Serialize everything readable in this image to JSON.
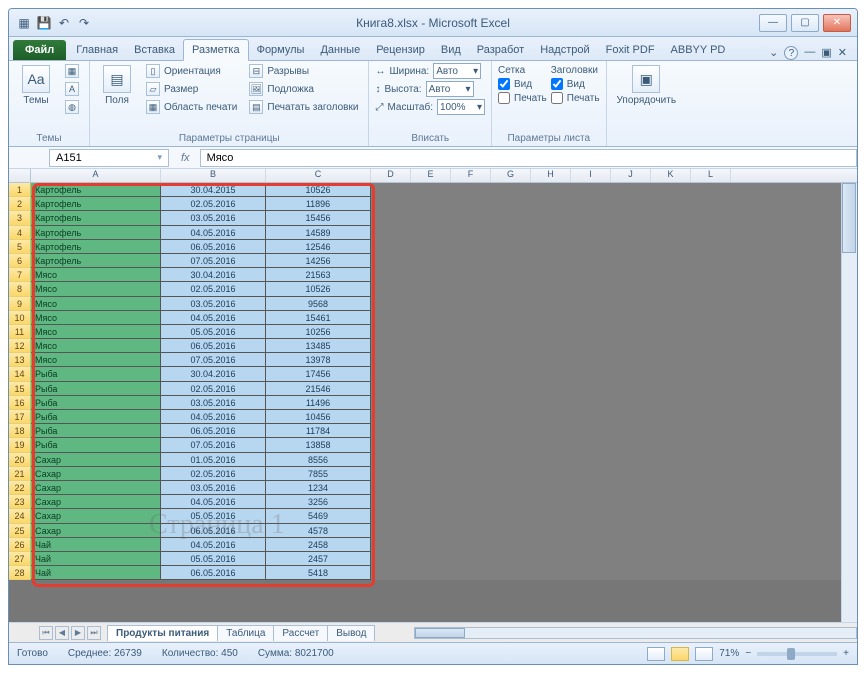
{
  "window": {
    "title": "Книга8.xlsx - Microsoft Excel"
  },
  "qat": {
    "save": "💾",
    "undo": "↶",
    "redo": "↷"
  },
  "tabs": {
    "file": "Файл",
    "items": [
      "Главная",
      "Вставка",
      "Разметка",
      "Формулы",
      "Данные",
      "Рецензир",
      "Вид",
      "Разработ",
      "Надстрой",
      "Foxit PDF",
      "ABBYY PD"
    ],
    "active_index": 2
  },
  "ribbon": {
    "group_themes": {
      "label": "Темы",
      "themes": "Темы"
    },
    "group_page": {
      "label": "Параметры страницы",
      "margins": "Поля",
      "orientation": "Ориентация",
      "size": "Размер",
      "print_area": "Область печати",
      "breaks": "Разрывы",
      "background": "Подложка",
      "titles": "Печатать заголовки"
    },
    "group_fit": {
      "label": "Вписать",
      "width_lbl": "Ширина:",
      "width_val": "Авто",
      "height_lbl": "Высота:",
      "height_val": "Авто",
      "scale_lbl": "Масштаб:",
      "scale_val": "100%"
    },
    "group_sheet": {
      "label": "Параметры листа",
      "grid": "Сетка",
      "headings": "Заголовки",
      "view": "Вид",
      "print": "Печать"
    },
    "group_arrange": {
      "label": "",
      "arrange": "Упорядочить"
    }
  },
  "formula_bar": {
    "name_box": "A151",
    "fx": "fx",
    "formula": "Мясо"
  },
  "columns": [
    "A",
    "B",
    "C",
    "D",
    "E",
    "F",
    "G",
    "H",
    "I",
    "J",
    "K",
    "L"
  ],
  "rows": [
    {
      "n": 1,
      "a": "Картофель",
      "b": "30.04.2015",
      "c": "10526"
    },
    {
      "n": 2,
      "a": "Картофель",
      "b": "02.05.2016",
      "c": "11896"
    },
    {
      "n": 3,
      "a": "Картофель",
      "b": "03.05.2016",
      "c": "15456"
    },
    {
      "n": 4,
      "a": "Картофель",
      "b": "04.05.2016",
      "c": "14589"
    },
    {
      "n": 5,
      "a": "Картофель",
      "b": "06.05.2016",
      "c": "12546"
    },
    {
      "n": 6,
      "a": "Картофель",
      "b": "07.05.2016",
      "c": "14256"
    },
    {
      "n": 7,
      "a": "Мясо",
      "b": "30.04.2016",
      "c": "21563"
    },
    {
      "n": 8,
      "a": "Мясо",
      "b": "02.05.2016",
      "c": "10526"
    },
    {
      "n": 9,
      "a": "Мясо",
      "b": "03.05.2016",
      "c": "9568"
    },
    {
      "n": 10,
      "a": "Мясо",
      "b": "04.05.2016",
      "c": "15461"
    },
    {
      "n": 11,
      "a": "Мясо",
      "b": "05.05.2016",
      "c": "10256"
    },
    {
      "n": 12,
      "a": "Мясо",
      "b": "06.05.2016",
      "c": "13485"
    },
    {
      "n": 13,
      "a": "Мясо",
      "b": "07.05.2016",
      "c": "13978"
    },
    {
      "n": 14,
      "a": "Рыба",
      "b": "30.04.2016",
      "c": "17456"
    },
    {
      "n": 15,
      "a": "Рыба",
      "b": "02.05.2016",
      "c": "21546"
    },
    {
      "n": 16,
      "a": "Рыба",
      "b": "03.05.2016",
      "c": "11496"
    },
    {
      "n": 17,
      "a": "Рыба",
      "b": "04.05.2016",
      "c": "10456"
    },
    {
      "n": 18,
      "a": "Рыба",
      "b": "06.05.2016",
      "c": "11784"
    },
    {
      "n": 19,
      "a": "Рыба",
      "b": "07.05.2016",
      "c": "13858"
    },
    {
      "n": 20,
      "a": "Сахар",
      "b": "01.05.2016",
      "c": "8556"
    },
    {
      "n": 21,
      "a": "Сахар",
      "b": "02.05.2016",
      "c": "7855"
    },
    {
      "n": 22,
      "a": "Сахар",
      "b": "03.05.2016",
      "c": "1234"
    },
    {
      "n": 23,
      "a": "Сахар",
      "b": "04.05.2016",
      "c": "3256"
    },
    {
      "n": 24,
      "a": "Сахар",
      "b": "05.05.2016",
      "c": "5469"
    },
    {
      "n": 25,
      "a": "Сахар",
      "b": "06.05.2016",
      "c": "4578"
    },
    {
      "n": 26,
      "a": "Чай",
      "b": "04.05.2016",
      "c": "2458"
    },
    {
      "n": 27,
      "a": "Чай",
      "b": "05.05.2016",
      "c": "2457"
    },
    {
      "n": 28,
      "a": "Чай",
      "b": "06.05.2016",
      "c": "5418"
    }
  ],
  "watermark": "Страница 1",
  "sheets": {
    "items": [
      "Продукты питания",
      "Таблица",
      "Рассчет",
      "Вывод"
    ],
    "active_index": 0
  },
  "status": {
    "ready": "Готово",
    "avg_lbl": "Среднее:",
    "avg_val": "26739",
    "count_lbl": "Количество:",
    "count_val": "450",
    "sum_lbl": "Сумма:",
    "sum_val": "8021700",
    "zoom": "71%"
  }
}
